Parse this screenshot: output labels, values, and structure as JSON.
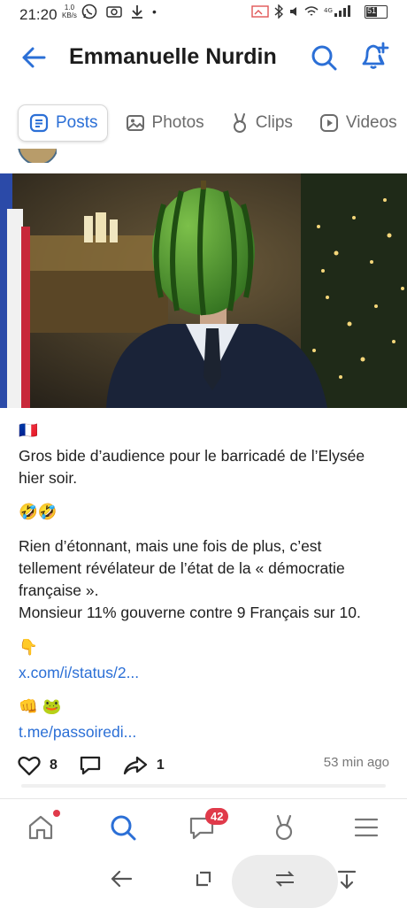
{
  "status_bar": {
    "time": "21:20",
    "speed_value": "1.0",
    "speed_unit": "KB/s",
    "battery": "51",
    "signal": "4G"
  },
  "app_bar": {
    "title": "Emmanuelle Nurdin"
  },
  "tabs": [
    {
      "label": "Posts",
      "icon": "posts-icon",
      "active": true
    },
    {
      "label": "Photos",
      "icon": "photo-icon",
      "active": false
    },
    {
      "label": "Clips",
      "icon": "clips-icon",
      "active": false
    },
    {
      "label": "Videos",
      "icon": "video-icon",
      "active": false
    }
  ],
  "post": {
    "flag": "🇫🇷",
    "line1": "Gros bide d’audience pour le barricadé de l’Elysée",
    "line2": "hier soir.",
    "emojis1": "🤣🤣",
    "p2_line1": "Rien d’étonnant, mais une fois de plus, c’est",
    "p2_line2": "tellement révélateur de l’état de la « démocratie",
    "p2_line3": "française ».",
    "p2_line4": "Monsieur 11% gouverne contre 9 Français sur 10.",
    "pointer": "👇",
    "link1": "x.com/i/status/2...",
    "emojis2": "👊 🐸",
    "link2": "t.me/passoiredi...",
    "likes": "8",
    "reposts": "1",
    "time_ago": "53 min ago"
  },
  "bottom_nav": {
    "messages_badge": "42"
  },
  "colors": {
    "accent": "#2b6fd6",
    "badge": "#e03a4a"
  }
}
